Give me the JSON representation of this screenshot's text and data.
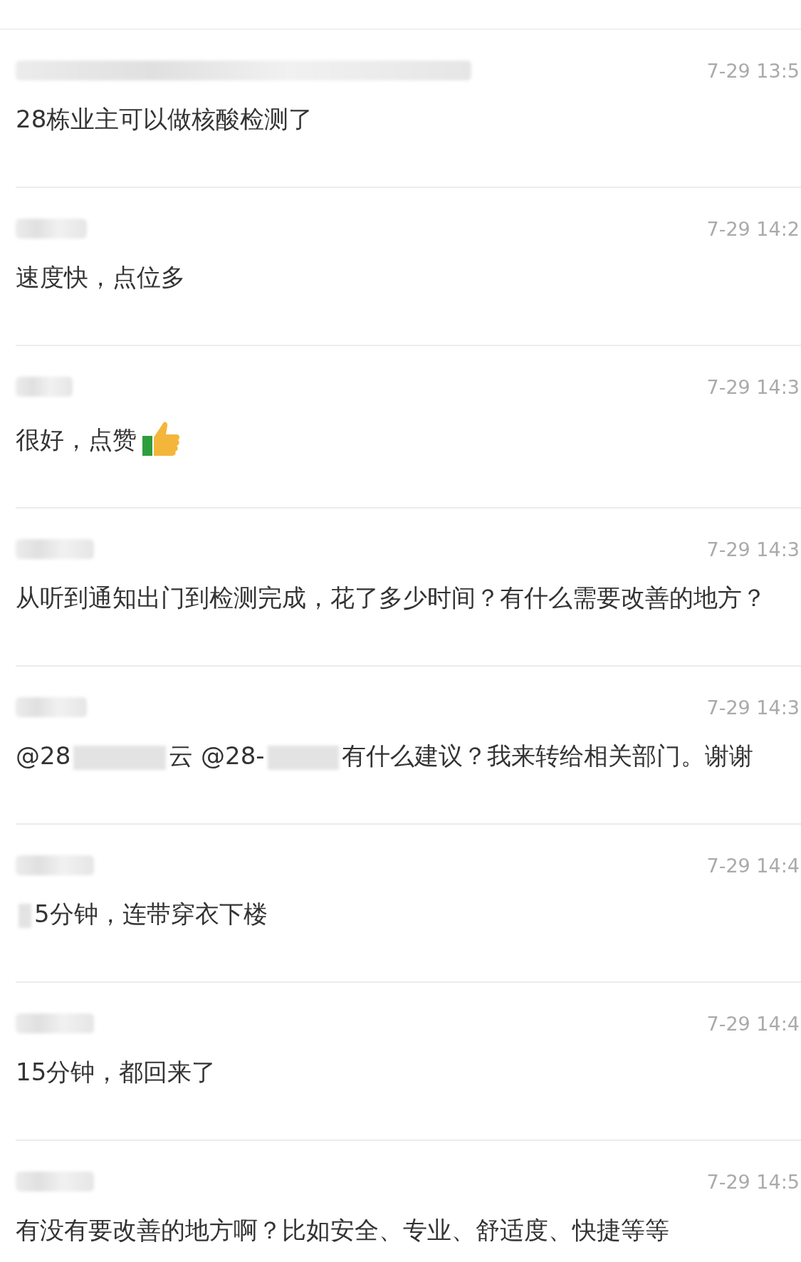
{
  "comments": [
    {
      "time": "7-29 13:5",
      "message": [
        {
          "kind": "text",
          "text": "28栋业主可以做核酸检测了"
        }
      ]
    },
    {
      "time": "7-29 14:2",
      "message": [
        {
          "kind": "text",
          "text": "速度快，点位多"
        }
      ]
    },
    {
      "time": "7-29 14:3",
      "message": [
        {
          "kind": "text",
          "text": "很好，点赞"
        },
        {
          "kind": "emoji"
        }
      ]
    },
    {
      "time": "7-29 14:3",
      "message": [
        {
          "kind": "text",
          "text": "从听到通知出门到检测完成，花了多少时间？有什么需要改善的地方？"
        }
      ]
    },
    {
      "time": "7-29 14:3",
      "message": [
        {
          "kind": "text",
          "text": "@28"
        },
        {
          "kind": "redacted"
        },
        {
          "kind": "text",
          "text": "云 @28-"
        },
        {
          "kind": "redacted"
        },
        {
          "kind": "text",
          "text": "有什么建议？我来转给相关部门。谢谢"
        }
      ]
    },
    {
      "time": "7-29 14:4",
      "message": [
        {
          "kind": "redacted"
        },
        {
          "kind": "text",
          "text": "5分钟，连带穿衣下楼"
        }
      ]
    },
    {
      "time": "7-29 14:4",
      "message": [
        {
          "kind": "text",
          "text": "15分钟，都回来了"
        }
      ]
    },
    {
      "time": "7-29 14:5",
      "message": [
        {
          "kind": "text",
          "text": "有没有要改善的地方啊？比如安全、专业、舒适度、快捷等等"
        }
      ]
    }
  ]
}
